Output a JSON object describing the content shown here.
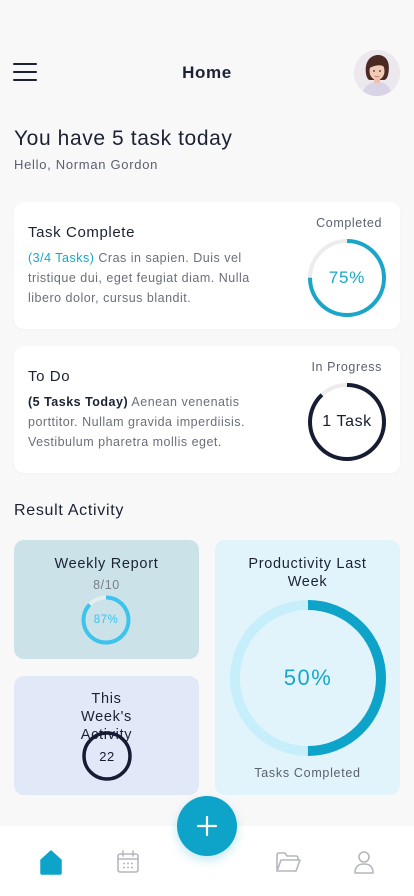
{
  "header": {
    "title": "Home",
    "menu_icon": "hamburger-menu-icon",
    "avatar_alt": "user-avatar"
  },
  "greeting": {
    "title": "You have 5 task today",
    "subtitle": "Hello, Norman Gordon"
  },
  "cards": {
    "task_complete": {
      "title": "Task Complete",
      "highlight": "(3/4 Tasks)",
      "description": " Cras in sapien. Duis vel tristique dui, eget feugiat diam. Nulla libero dolor, cursus blandit.",
      "status": "Completed",
      "ring_label": "75%",
      "progress": 0.75,
      "color": "#1aa6c9"
    },
    "todo": {
      "title": "To Do",
      "highlight": "(5 Tasks Today)",
      "description": " Aenean venenatis porttitor. Nullam gravida imperdiisis. Vestibulum pharetra mollis eget.",
      "status": "In Progress",
      "ring_label": "1 Task",
      "progress": 0.88,
      "color": "#161c33"
    }
  },
  "result_activity": {
    "title": "Result Activity",
    "weekly_report": {
      "title": "Weekly Report",
      "score": "8/10",
      "ring_label": "87%",
      "progress": 0.87,
      "bg": "#cbe2e9",
      "color": "#3dc3ec"
    },
    "this_week": {
      "title": "This Week's Activity",
      "ring_label": "22",
      "bg": "#e1e8f7",
      "color": "#161c33"
    },
    "productivity": {
      "title": "Productivity Last Week",
      "ring_label": "50%",
      "progress": 0.5,
      "caption": "Tasks Completed",
      "bg": "#e2f4fb",
      "color": "#0ea3c8",
      "track": "#c6effb"
    }
  },
  "bottom_nav": {
    "items": [
      "home-icon",
      "calendar-icon",
      "folder-icon",
      "profile-icon"
    ],
    "active": "home-icon",
    "fab_icon": "plus-icon",
    "accent": "#0ea3c8"
  }
}
